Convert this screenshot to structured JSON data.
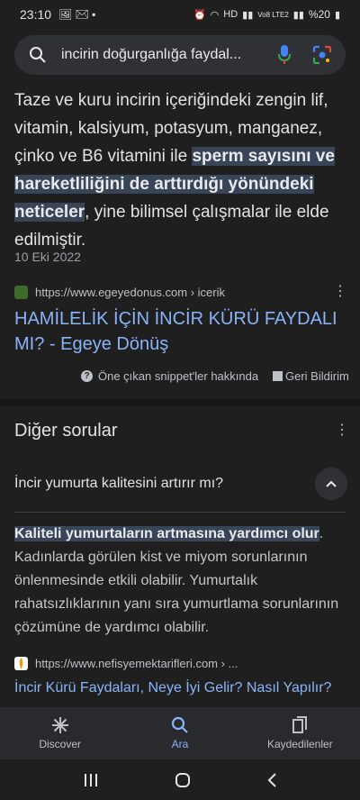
{
  "status": {
    "time": "23:10",
    "net": "Vo8 LTE2",
    "battery": "%20"
  },
  "search": {
    "query": "incirin doğurganlığa faydal..."
  },
  "snippet": {
    "pre": "Taze ve kuru incirin içeriğindeki zengin lif, vitamin, kalsiyum, potasyum, manganez, çinko ve B6 vitamini ile ",
    "highlight": "sperm sayısını ve hareketliliğini de arttırdığı yönündeki neticeler",
    "post": ", yine bilimsel çalışmalar ile elde edilmiştir.",
    "date": "10 Eki 2022",
    "source_url": "https://www.egeyedonus.com › icerik",
    "result_title": "HAMİLELİK İÇİN İNCİR KÜRÜ FAYDALI MI? - Egeye Dönüş",
    "about_label": "Öne çıkan snippet'ler hakkında",
    "feedback_label": "Geri Bildirim"
  },
  "other_questions": {
    "title": "Diğer sorular",
    "question": "İncir yumurta kalitesini artırır mı?",
    "answer_highlight": "Kaliteli yumurtaların artmasına yardımcı olur",
    "answer_rest": ". Kadınlarda görülen kist ve miyom sorunlarının önlenmesinde etkili olabilir. Yumurtalık rahatsızlıklarının yanı sıra yumurtlama sorunlarının çözümüne de yardımcı olabilir.",
    "source_url": "https://www.nefisyemektarifleri.com › ...",
    "result_title": "İncir Kürü Faydaları, Neye İyi Gelir? Nasıl Yapılır?"
  },
  "bottom_nav": {
    "discover": "Discover",
    "search": "Ara",
    "saved": "Kaydedilenler"
  },
  "colors": {
    "link": "#8ab4f8",
    "highlight_bg": "#394457"
  }
}
